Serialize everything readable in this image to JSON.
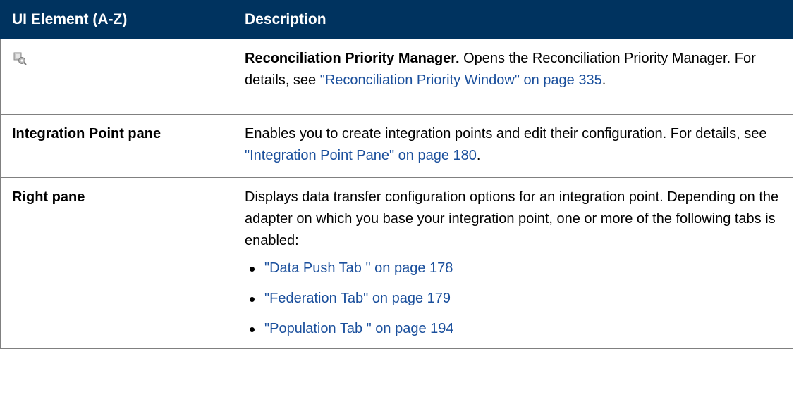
{
  "header": {
    "col_element": "UI Element (A-Z)",
    "col_description": "Description"
  },
  "rows": [
    {
      "icon": "reconciliation-priority-icon",
      "term": "Reconciliation Priority Manager.",
      "text": " Opens the Reconciliation Priority Manager. For details, see ",
      "link": "\"Reconciliation Priority Window\" on page 335",
      "after": "."
    },
    {
      "element": "Integration Point pane",
      "text": "Enables you to create integration points and edit their configuration. For details, see ",
      "link": "\"Integration Point Pane\" on page 180",
      "after": "."
    },
    {
      "element": "Right pane",
      "text": "Displays data transfer configuration options for an integration point. Depending on the adapter on which you base your integration point, one or more of the following tabs is enabled:",
      "links": [
        "\"Data Push Tab \" on page 178",
        "\"Federation Tab\" on page 179",
        "\"Population Tab \" on page 194"
      ]
    }
  ],
  "colors": {
    "header_bg": "#00335f",
    "link": "#1a4f9c"
  }
}
